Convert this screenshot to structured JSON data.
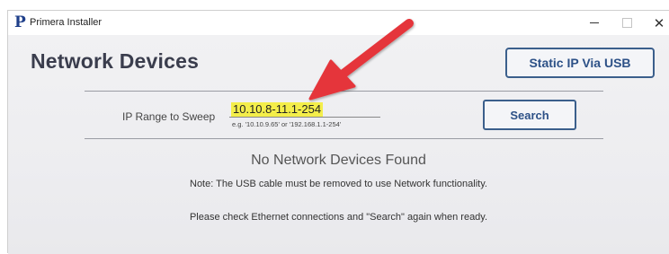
{
  "window": {
    "title": "Primera Installer",
    "logo_glyph": "P",
    "controls": {
      "minimize": "minimize",
      "maximize": "maximize",
      "close": "✕"
    }
  },
  "main": {
    "page_title": "Network Devices",
    "static_ip_button": "Static IP Via USB",
    "ip_range": {
      "label": "IP Range to Sweep",
      "value": "10.10.8-11.1-254",
      "hint": "e.g. '10.10.9.65' or '192.168.1.1-254'"
    },
    "search_button": "Search",
    "empty_message": "No Network Devices Found",
    "note": "Note: The USB cable must be removed to use Network functionality.",
    "check_message": "Please check Ethernet connections and \"Search\" again when ready."
  },
  "colors": {
    "accent": "#2d5187",
    "highlight": "#f4ee4a",
    "annotation_arrow": "#e5363b"
  }
}
